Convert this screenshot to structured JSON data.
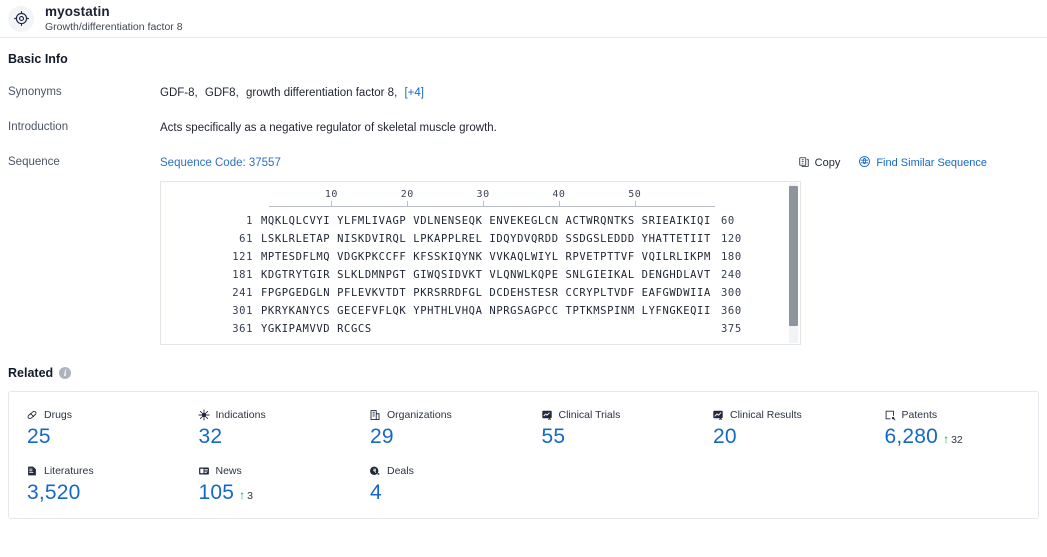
{
  "header": {
    "icon": "target-icon",
    "title": "myostatin",
    "subtitle": "Growth/differentiation factor 8"
  },
  "basic_info": {
    "section_title": "Basic Info",
    "synonyms": {
      "label": "Synonyms",
      "items": [
        "GDF-8,",
        "GDF8,",
        "growth differentiation factor 8,"
      ],
      "more": "[+4]"
    },
    "introduction": {
      "label": "Introduction",
      "text": "Acts specifically as a negative regulator of skeletal muscle growth."
    },
    "sequence": {
      "label": "Sequence",
      "code_text": "Sequence Code: 37557",
      "copy_label": "Copy",
      "copy_icon": "copy-icon",
      "similar_label": "Find Similar Sequence",
      "similar_icon": "find-similar-icon",
      "ruler": [
        10,
        20,
        30,
        40,
        50
      ],
      "lines": [
        {
          "start": "1",
          "chunks": "MQKLQLCVYI YLFMLIVAGP VDLNENSEQK ENVEKEGLCN ACTWRQNTKS SRIEAIKIQI",
          "end": "60"
        },
        {
          "start": "61",
          "chunks": "LSKLRLETAP NISKDVIRQL LPKAPPLREL IDQYDVQRDD SSDGSLEDDD YHATTETIIT",
          "end": "120"
        },
        {
          "start": "121",
          "chunks": "MPTESDFLMQ VDGKPKCCFF KFSSKIQYNK VVKAQLWIYL RPVETPTTVF VQILRLIKPM",
          "end": "180"
        },
        {
          "start": "181",
          "chunks": "KDGTRYTGIR SLKLDMNPGT GIWQSIDVKT VLQNWLKQPE SNLGIEIKAL DENGHDLAVT",
          "end": "240"
        },
        {
          "start": "241",
          "chunks": "FPGPGEDGLN PFLEVKVTDT PKRSRRDFGL DCDEHSTESR CCRYPLTVDF EAFGWDWIIA",
          "end": "300"
        },
        {
          "start": "301",
          "chunks": "PKRYKANYCS GECEFVFLQK YPHTHLVHQA NPRGSAGPCC TPTKMSPINM LYFNGKEQII",
          "end": "360"
        },
        {
          "start": "361",
          "chunks": "YGKIPAMVVD RCGCS",
          "end": "375"
        }
      ]
    }
  },
  "related": {
    "section_title": "Related",
    "info_icon": "info-icon",
    "stats": [
      {
        "label": "Drugs",
        "icon": "pill-icon",
        "value": "25"
      },
      {
        "label": "Indications",
        "icon": "virus-icon",
        "value": "32"
      },
      {
        "label": "Organizations",
        "icon": "building-icon",
        "value": "29"
      },
      {
        "label": "Clinical Trials",
        "icon": "clinical-trial-icon",
        "value": "55"
      },
      {
        "label": "Clinical Results",
        "icon": "clinical-result-icon",
        "value": "20"
      },
      {
        "label": "Patents",
        "icon": "patent-icon",
        "value": "6,280",
        "delta": "32",
        "delta_dir": "up"
      },
      {
        "label": "Literatures",
        "icon": "book-icon",
        "value": "3,520"
      },
      {
        "label": "News",
        "icon": "news-icon",
        "value": "105",
        "delta": "3",
        "delta_dir": "up"
      },
      {
        "label": "Deals",
        "icon": "deal-icon",
        "value": "4"
      }
    ]
  },
  "colors": {
    "accent_blue": "#1668c8",
    "link_blue": "#2e6fc4",
    "delta_green": "#18a04a",
    "border": "#e4e7ec"
  }
}
